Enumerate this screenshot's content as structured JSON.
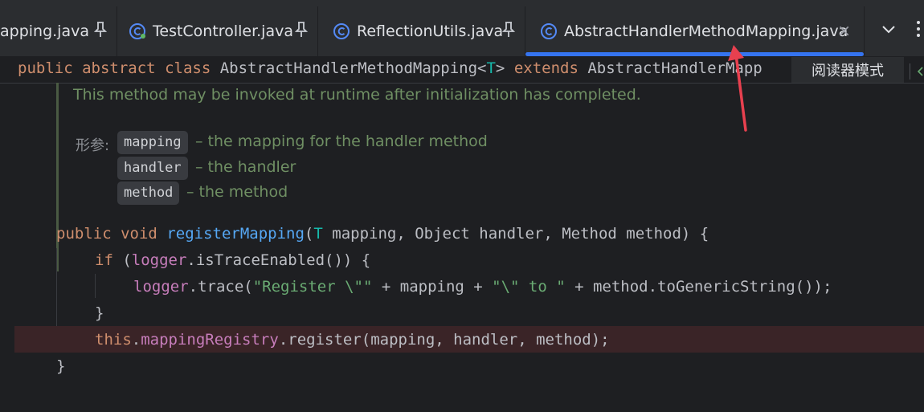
{
  "tabs": [
    {
      "label": "apping.java",
      "active": false,
      "pinned": true
    },
    {
      "label": "TestController.java",
      "active": false,
      "pinned": true
    },
    {
      "label": "ReflectionUtils.java",
      "active": false,
      "pinned": true
    },
    {
      "label": "AbstractHandlerMethodMapping.java",
      "active": true,
      "pinned": false
    }
  ],
  "tab_close_glyph": "×",
  "sticky_header": {
    "kw1": "public",
    "kw2": "abstract",
    "kw3": "class",
    "name": "AbstractHandlerMethodMapping",
    "lt": "<",
    "typeparam": "T",
    "gt": ">",
    "kw4": "extends",
    "parent": "AbstractHandlerMapp"
  },
  "reader_mode_label": "阅读器模式",
  "doc": {
    "line1": "This method may be invoked at runtime after initialization has completed.",
    "params_label": "形参:",
    "params": [
      {
        "name": "mapping",
        "desc": "– the mapping for the handler method"
      },
      {
        "name": "handler",
        "desc": "– the handler"
      },
      {
        "name": "method",
        "desc": "– the method"
      }
    ]
  },
  "code": {
    "l1_kw1": "public",
    "l1_kw2": "void",
    "l1_fn": "registerMapping",
    "l1_open": "(",
    "l1_tp": "T",
    "l1_rest": " mapping, Object handler, Method method) {",
    "l2_kw": "if",
    "l2_open": " (",
    "l2_field": "logger",
    "l2_rest": ".isTraceEnabled()) {",
    "l3_field": "logger",
    "l3_call": ".trace(",
    "l3_str1": "\"Register \\\"\"",
    "l3_mid1": " + mapping + ",
    "l3_str2": "\"\\\" to \"",
    "l3_mid2": " + method.toGenericString());",
    "l4": "}",
    "l5_kw": "this",
    "l5_dot": ".",
    "l5_field": "mappingRegistry",
    "l5_rest": ".register(mapping, handler, method);",
    "l6": "}"
  },
  "colors": {
    "accent": "#3574f0",
    "arrow": "#e8404f",
    "highlight_line": "#3a2427"
  },
  "icons": [
    "class-file-icon",
    "pin-icon",
    "close-icon",
    "chevron-down-icon",
    "more-vertical-icon",
    "arrow-annotation-icon"
  ]
}
